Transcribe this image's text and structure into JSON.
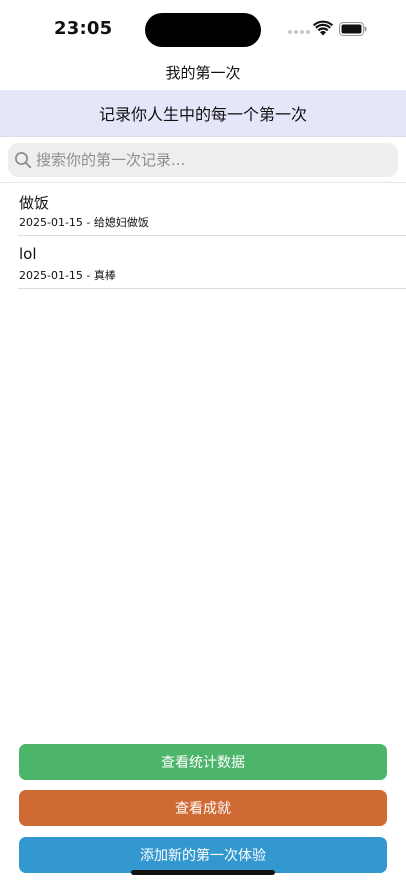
{
  "status_bar": {
    "time": "23:05",
    "signal_icon": "cellular-signal-icon",
    "wifi_icon": "wifi-icon",
    "battery_icon": "battery-icon"
  },
  "nav": {
    "title": "我的第一次"
  },
  "banner": {
    "text": "记录你人生中的每一个第一次",
    "background": "#e6e6fa"
  },
  "search": {
    "icon": "search-icon",
    "placeholder": "搜索你的第一次记录...",
    "value": ""
  },
  "records": [
    {
      "title": "做饭",
      "subtitle": "2025-01-15 - 给媳妇做饭"
    },
    {
      "title": "lol",
      "subtitle": "2025-01-15 - 真棒"
    }
  ],
  "buttons": {
    "stats": {
      "label": "查看统计数据",
      "color": "#4cb56a"
    },
    "achievements": {
      "label": "查看成就",
      "color": "#cf6a35"
    },
    "add": {
      "label": "添加新的第一次体验",
      "color": "#3398d0"
    }
  }
}
